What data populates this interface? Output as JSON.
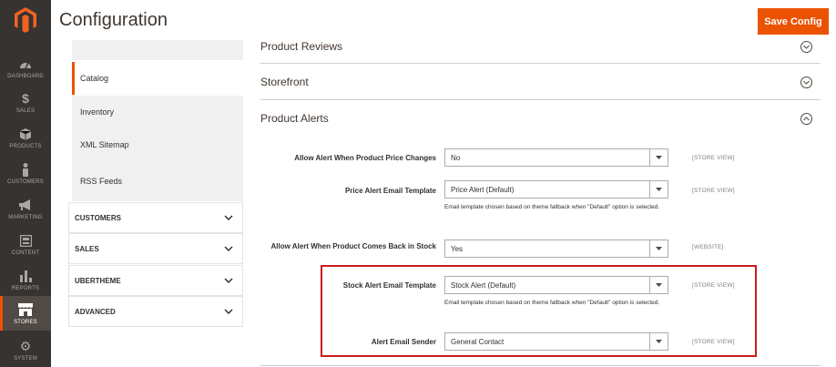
{
  "nav": [
    {
      "label": "DASHBOARD",
      "icon": "dashboard-icon"
    },
    {
      "label": "SALES",
      "icon": "dollar-icon"
    },
    {
      "label": "PRODUCTS",
      "icon": "cube-icon"
    },
    {
      "label": "CUSTOMERS",
      "icon": "person-icon"
    },
    {
      "label": "MARKETING",
      "icon": "megaphone-icon"
    },
    {
      "label": "CONTENT",
      "icon": "content-icon"
    },
    {
      "label": "REPORTS",
      "icon": "bar-chart-icon"
    },
    {
      "label": "STORES",
      "icon": "store-icon"
    },
    {
      "label": "SYSTEM",
      "icon": "gear-icon"
    }
  ],
  "header": {
    "title": "Configuration",
    "save_label": "Save Config"
  },
  "left_tabs": {
    "catalog": "Catalog",
    "inventory": "Inventory",
    "xml_sitemap": "XML Sitemap",
    "rss_feeds": "RSS Feeds"
  },
  "groups": {
    "customers": "CUSTOMERS",
    "sales": "SALES",
    "ubertheme": "UBERTHEME",
    "advanced": "ADVANCED"
  },
  "sections": {
    "product_reviews": "Product Reviews",
    "storefront": "Storefront",
    "product_alerts": "Product Alerts"
  },
  "fields": {
    "price_change": {
      "label": "Allow Alert When Product Price Changes",
      "value": "No",
      "scope": "[STORE VIEW]"
    },
    "price_template": {
      "label": "Price Alert Email Template",
      "value": "Price Alert (Default)",
      "note": "Email template chosen based on theme fallback when \"Default\" option is selected.",
      "scope": "[STORE VIEW]"
    },
    "back_in_stock": {
      "label": "Allow Alert When Product Comes Back in Stock",
      "value": "Yes",
      "scope": "[WEBSITE]"
    },
    "stock_template": {
      "label": "Stock Alert Email Template",
      "value": "Stock Alert (Default)",
      "note": "Email template chosen based on theme fallback when \"Default\" option is selected.",
      "scope": "[STORE VIEW]"
    },
    "sender": {
      "label": "Alert Email Sender",
      "value": "General Contact",
      "scope": "[STORE VIEW]"
    }
  },
  "colors": {
    "accent": "#eb5202",
    "highlight": "#c91c1c",
    "sidebar": "#373330"
  }
}
